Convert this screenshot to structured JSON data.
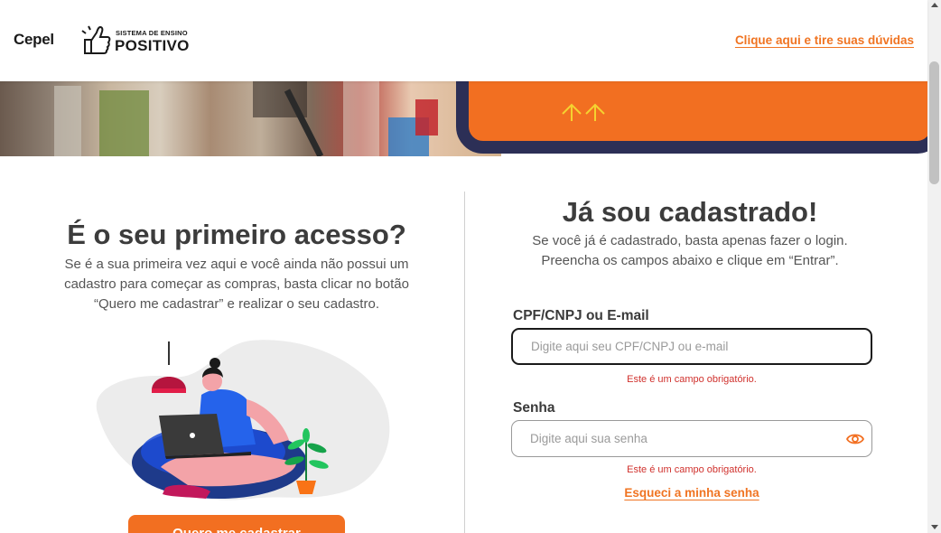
{
  "header": {
    "brand": "Cepel",
    "logo_small": "SISTEMA DE ENSINO",
    "logo_big": "POSITIVO",
    "help_link": "Clique aqui e tire suas dúvidas"
  },
  "first_access": {
    "title": "É o seu primeiro acesso?",
    "description": "Se é a sua primeira vez aqui e você ainda não possui um cadastro para começar as compras, basta clicar no botão “Quero me cadastrar” e realizar o seu cadastro.",
    "button_label": "Quero me cadastrar"
  },
  "login": {
    "title": "Já sou cadastrado!",
    "description_line1": "Se você já é cadastrado, basta apenas fazer o login.",
    "description_line2": "Preencha os campos abaixo e clique em “Entrar”.",
    "user_label": "CPF/CNPJ ou E-mail",
    "user_placeholder": "Digite aqui seu CPF/CNPJ ou e-mail",
    "user_value": "",
    "user_error": "Este é um campo obrigatório.",
    "password_label": "Senha",
    "password_placeholder": "Digite aqui sua senha",
    "password_value": "",
    "password_error": "Este é um campo obrigatório.",
    "forgot_link": "Esqueci a minha senha"
  },
  "colors": {
    "accent": "#f26f21",
    "navy": "#2c2f56",
    "error": "#d0312d"
  },
  "icons": {
    "logo": "thumbs-up-logo-icon",
    "password_toggle": "eye-icon",
    "banner_arrows": "double-up-arrow-icon"
  }
}
